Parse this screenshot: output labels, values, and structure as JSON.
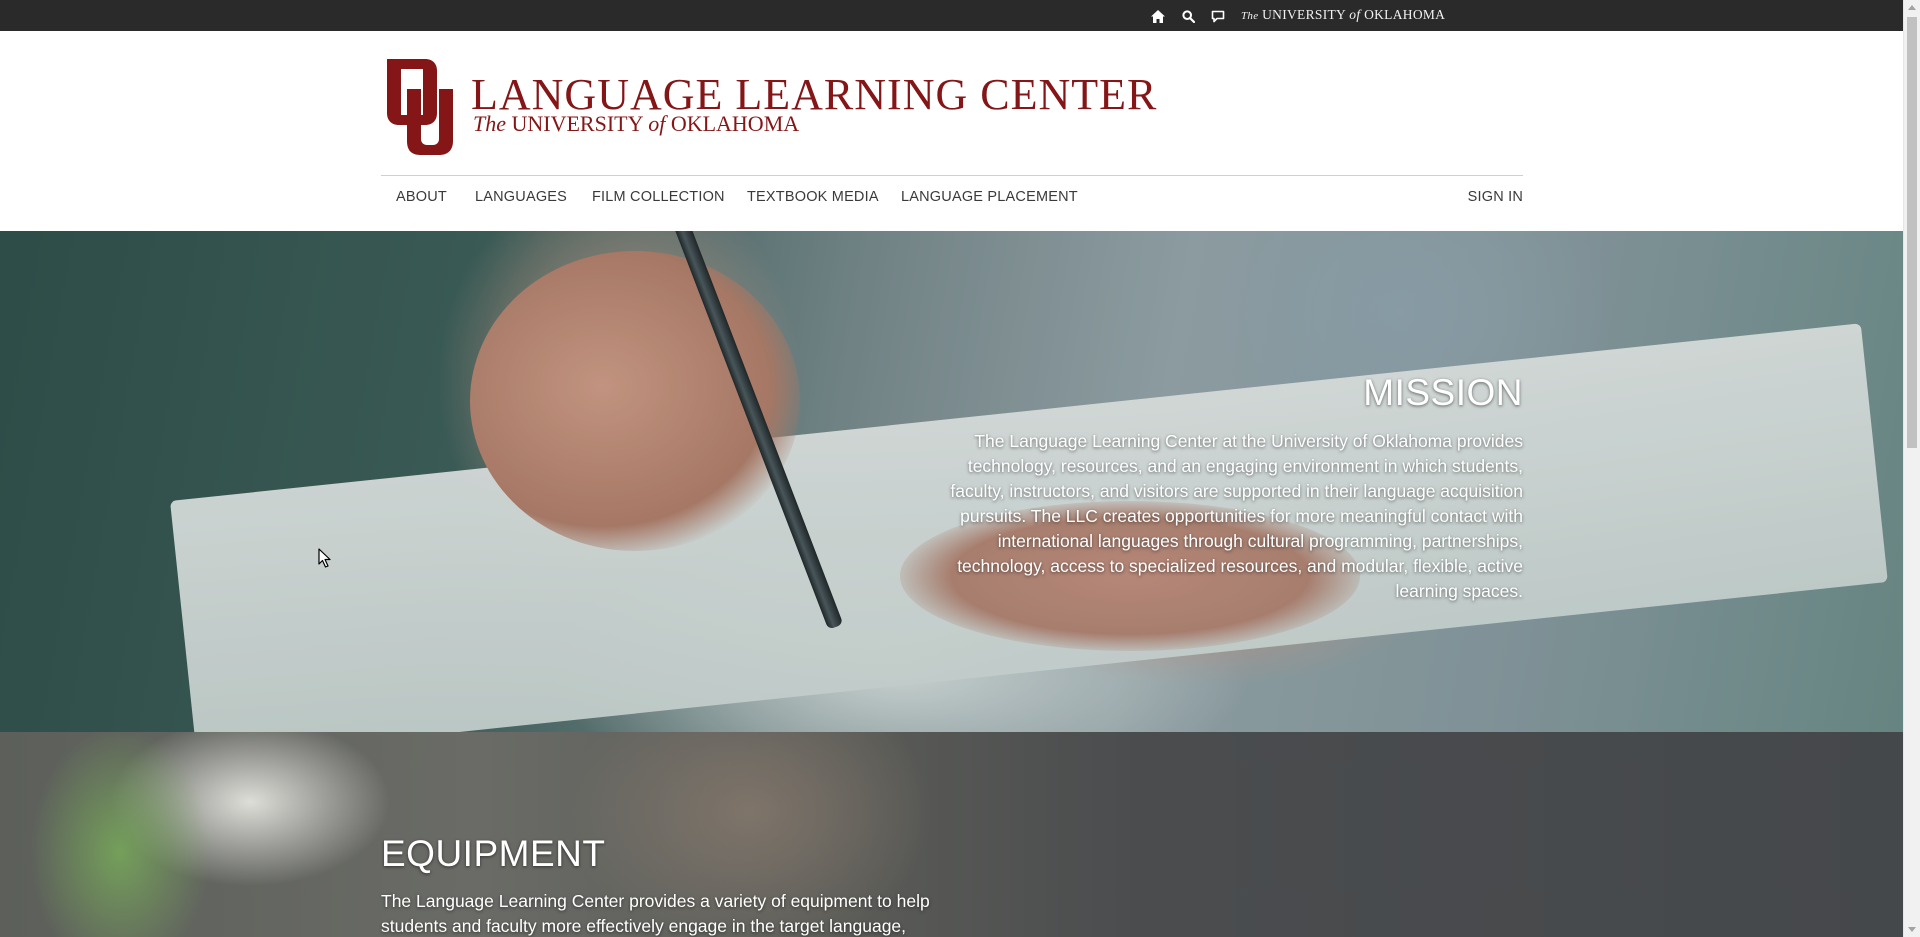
{
  "topbar": {
    "icons": [
      "home-icon",
      "search-icon",
      "chat-icon"
    ],
    "wordmark": {
      "the": "The",
      "university": "UNIVERSITY",
      "of": "of",
      "oklahoma": "OKLAHOMA"
    },
    "background": "#2a2a2a"
  },
  "header": {
    "title": "LANGUAGE LEARNING CENTER",
    "subtitle": {
      "the": "The",
      "university": "UNIVERSITY",
      "of": "of",
      "oklahoma": "OKLAHOMA"
    },
    "brand_color": "#841617",
    "logo": "ou-interlocking-logo"
  },
  "nav": {
    "items": [
      {
        "label": "ABOUT"
      },
      {
        "label": "LANGUAGES"
      },
      {
        "label": "FILM COLLECTION"
      },
      {
        "label": "TEXTBOOK MEDIA"
      },
      {
        "label": "LANGUAGE PLACEMENT"
      }
    ],
    "sign_in": "SIGN IN"
  },
  "mission": {
    "title": "MISSION",
    "body": "The Language Learning Center at the University of Oklahoma provides technology, resources, and an engaging environment in which students, faculty, instructors, and visitors are supported in their language acquisition pursuits. The LLC creates opportunities for more meaningful contact with international languages through cultural programming, partnerships, technology, access to specialized resources, and modular, flexible, active learning spaces."
  },
  "equipment": {
    "title": "EQUIPMENT",
    "body": "The Language Learning Center provides a variety of equipment to help students and faculty more effectively engage in the target language,"
  }
}
